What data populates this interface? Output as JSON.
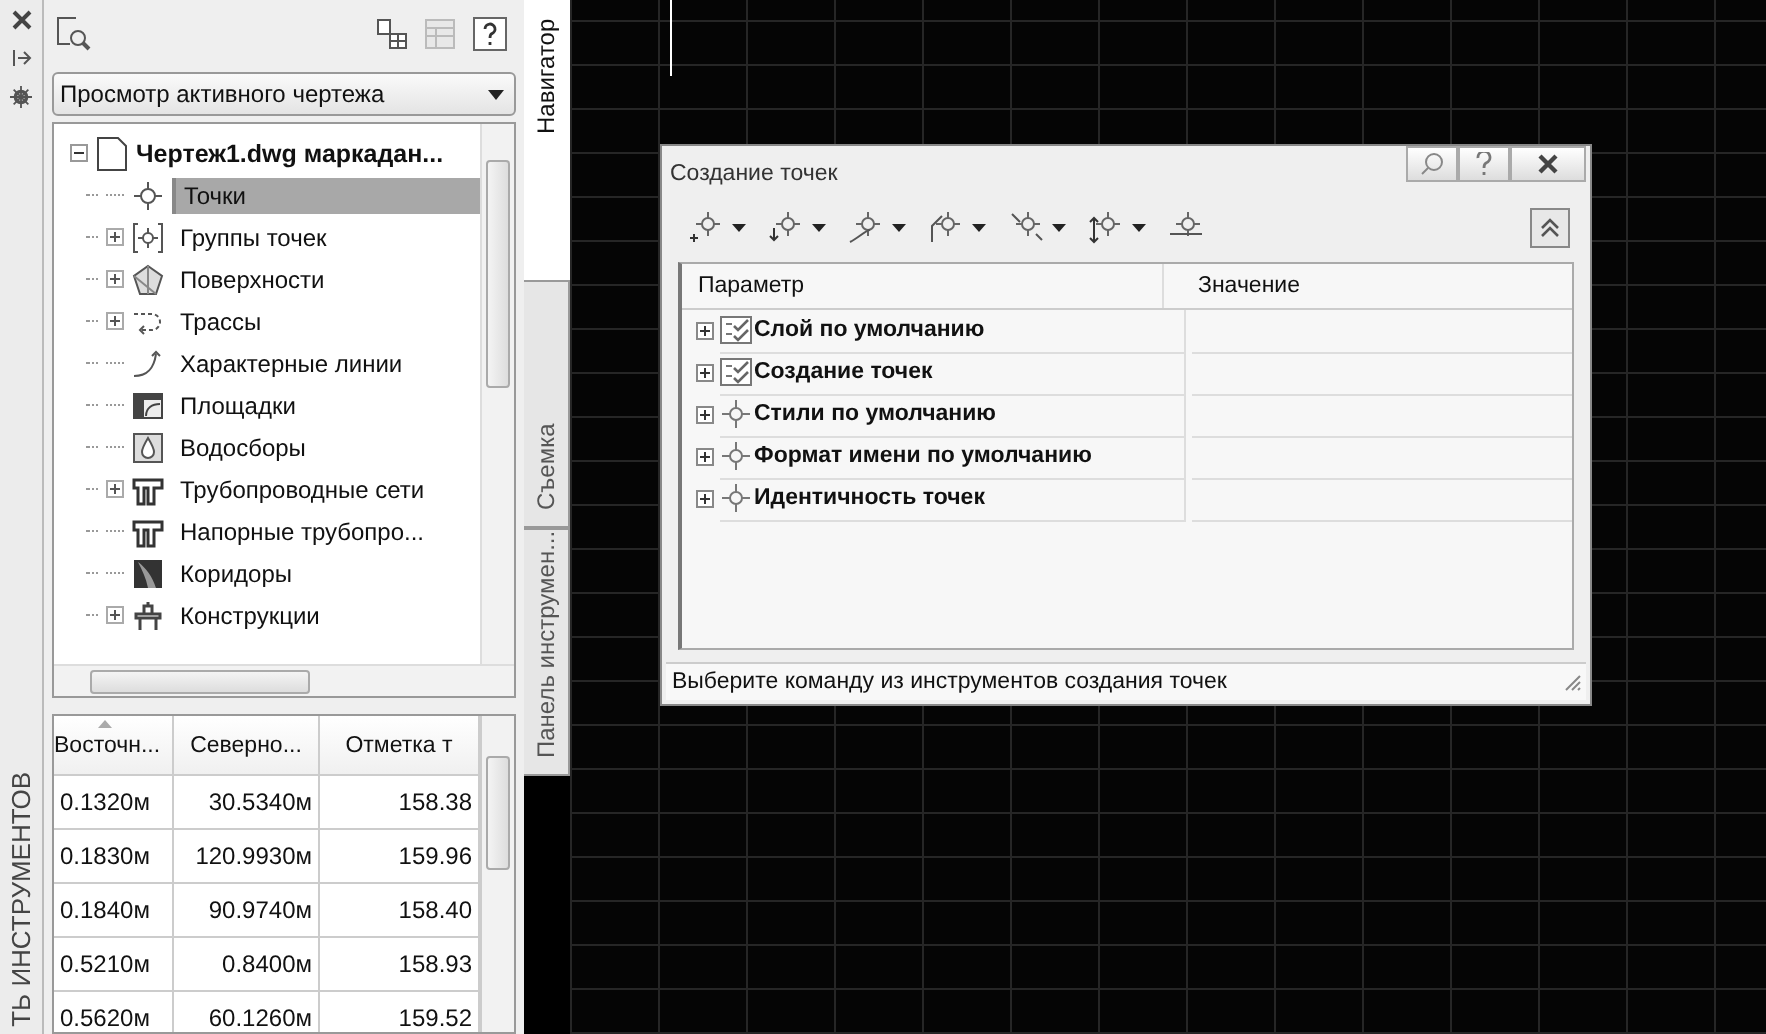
{
  "left_strip": {
    "vertical_title": "ТЬ ИНСТРУМЕНТОВ"
  },
  "panel": {
    "view_dropdown": {
      "value": "Просмотр активного чертежа"
    },
    "tree": {
      "label": "Чертеж1.dwg маркадан...",
      "expanded": true,
      "children": [
        {
          "label": "Точки",
          "expandable": false,
          "selected": true
        },
        {
          "label": "Группы точек",
          "expandable": true,
          "selected": false
        },
        {
          "label": "Поверхности",
          "expandable": true,
          "selected": false
        },
        {
          "label": "Трассы",
          "expandable": true,
          "selected": false
        },
        {
          "label": "Характерные линии",
          "expandable": false,
          "selected": false
        },
        {
          "label": "Площадки",
          "expandable": false,
          "selected": false
        },
        {
          "label": "Водосборы",
          "expandable": false,
          "selected": false
        },
        {
          "label": "Трубопроводные сети",
          "expandable": true,
          "selected": false
        },
        {
          "label": "Напорные трубопро...",
          "expandable": false,
          "selected": false
        },
        {
          "label": "Коридоры",
          "expandable": false,
          "selected": false
        },
        {
          "label": "Конструкции",
          "expandable": true,
          "selected": false
        }
      ]
    },
    "table": {
      "columns": [
        {
          "label": "Восточн...",
          "sorted": true
        },
        {
          "label": "Северно...",
          "sorted": false
        },
        {
          "label": "Отметка т",
          "sorted": false
        }
      ],
      "rows": [
        [
          "0.1320м",
          "30.5340м",
          "158.38"
        ],
        [
          "0.1830м",
          "120.9930м",
          "159.96"
        ],
        [
          "0.1840м",
          "90.9740м",
          "158.40"
        ],
        [
          "0.5210м",
          "0.8400м",
          "158.93"
        ],
        [
          "0.5620м",
          "60.1260м",
          "159.52"
        ]
      ]
    }
  },
  "side_tabs": [
    {
      "label": "Навигатор",
      "selected": true
    },
    {
      "label": "Съемка",
      "selected": false
    },
    {
      "label": "Панель инструмен...",
      "selected": false
    }
  ],
  "dialog": {
    "title": "Создание точек",
    "toolbar_buttons": [
      {
        "has_menu": true
      },
      {
        "has_menu": true
      },
      {
        "has_menu": true
      },
      {
        "has_menu": true
      },
      {
        "has_menu": true
      },
      {
        "has_menu": true
      },
      {
        "has_menu": false
      }
    ],
    "grid": {
      "columns": [
        "Параметр",
        "Значение"
      ],
      "rows": [
        {
          "label": "Слой по умолчанию",
          "kind": "settings",
          "expanded": false
        },
        {
          "label": "Создание точек",
          "kind": "settings",
          "expanded": false
        },
        {
          "label": "Стили по умолчанию",
          "kind": "point",
          "expanded": false
        },
        {
          "label": "Формат имени по умолчанию",
          "kind": "point",
          "expanded": false
        },
        {
          "label": "Идентичность точек",
          "kind": "point",
          "expanded": false
        }
      ]
    },
    "status": "Выберите команду из инструментов создания точек"
  }
}
